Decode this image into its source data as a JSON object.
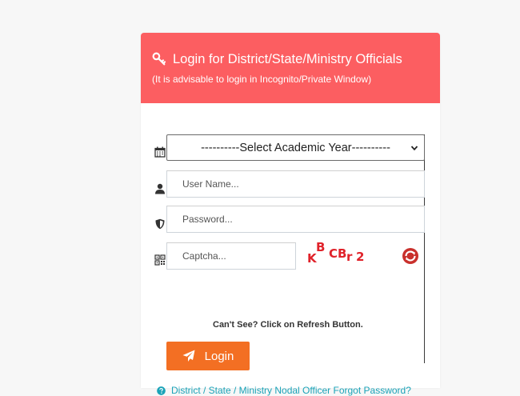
{
  "header": {
    "title": "Login for District/State/Ministry Officials",
    "subtitle": "(It is advisable to login in Incognito/Private Window)",
    "icon": "key-icon"
  },
  "form": {
    "academic_year": {
      "selected": "----------Select Academic Year----------",
      "icon": "calendar-icon"
    },
    "username": {
      "placeholder": "User Name...",
      "icon": "user-icon"
    },
    "password": {
      "placeholder": "Password...",
      "icon": "shield-icon"
    },
    "captcha": {
      "placeholder": "Captcha...",
      "icon": "qrcode-icon",
      "chars": [
        "K",
        "B",
        "C",
        "B",
        "r",
        "2"
      ],
      "refresh_icon": "refresh-icon"
    },
    "hint": "Can't See? Click on Refresh Button.",
    "login_label": "Login",
    "forgot_label": "District / State / Ministry Nodal Officer Forgot Password?"
  },
  "colors": {
    "header_bg": "#fc5e61",
    "login_button": "#f36f23",
    "link": "#1aa3b8",
    "captcha": "#e0222a"
  }
}
